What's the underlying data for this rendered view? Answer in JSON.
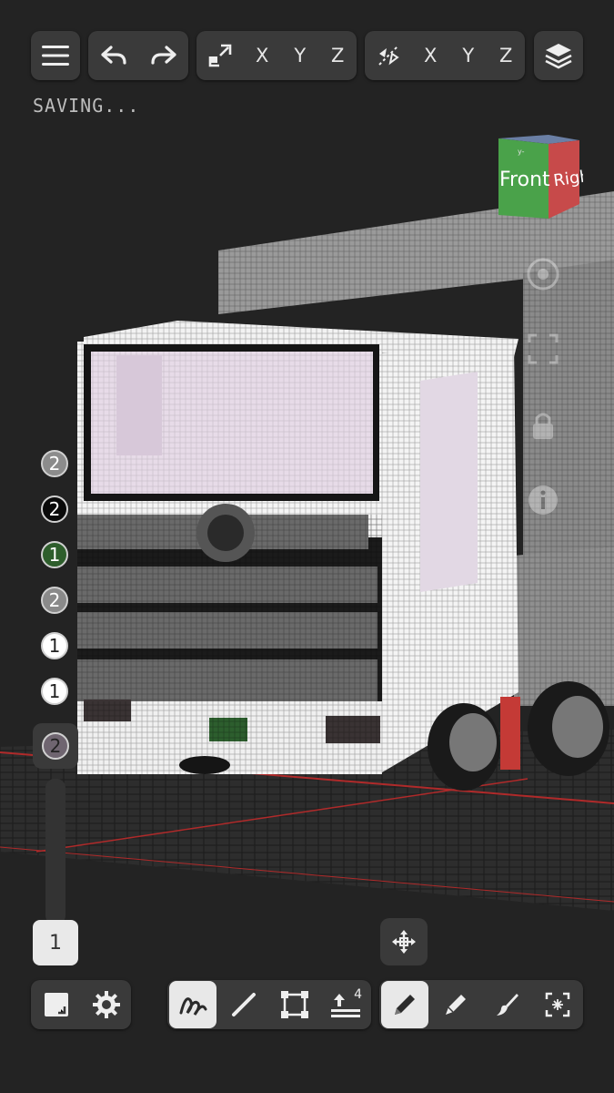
{
  "status": {
    "saving_text": "SAVING..."
  },
  "top_toolbar": {
    "mirror_axes": [
      "X",
      "Y",
      "Z"
    ],
    "symmetry_axes": [
      "X",
      "Y",
      "Z"
    ]
  },
  "view_cube": {
    "front_label": "Front",
    "right_label": "Right",
    "top_label": "y-"
  },
  "palette": {
    "swatches": [
      {
        "value": "2",
        "color": "#8c8c8c"
      },
      {
        "value": "2",
        "color": "#0a0a0a"
      },
      {
        "value": "1",
        "color": "#2e5e2c"
      },
      {
        "value": "2",
        "color": "#8a8a8a"
      },
      {
        "value": "1",
        "color": "#ffffff"
      },
      {
        "value": "1",
        "color": "#ffffff"
      }
    ],
    "selected": {
      "value": "2",
      "color": "#6f6570"
    }
  },
  "layer": {
    "value": "1"
  },
  "bottom_toolbar": {
    "height_badge": "4",
    "active_stroke_tool": "freehand",
    "active_mode": "draw"
  },
  "colors": {
    "background": "#232323",
    "panel": "#3a3a3a",
    "active": "#e8e8e8",
    "grid_red": "#b02a2a"
  }
}
